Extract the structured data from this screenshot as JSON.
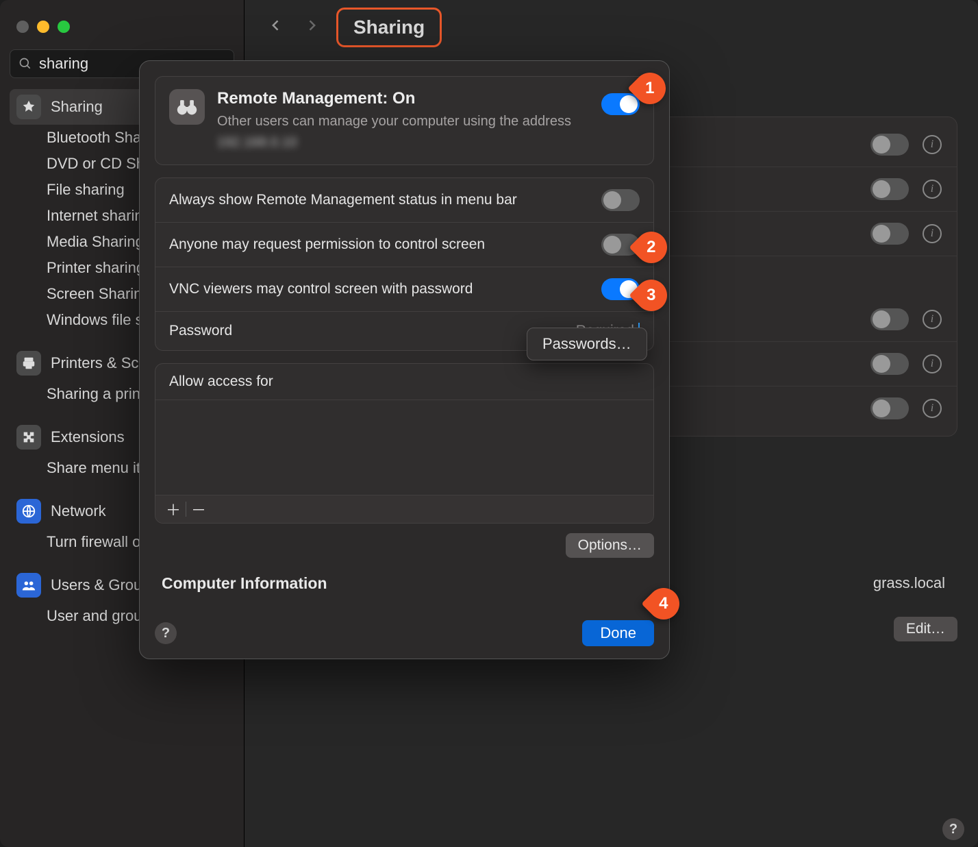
{
  "window": {
    "title": "Sharing"
  },
  "search": {
    "value": "sharing"
  },
  "sidebar": {
    "selected": "Sharing",
    "shared_items": [
      "Bluetooth Sharing",
      "DVD or CD Sharing",
      "File sharing",
      "Internet sharing",
      "Media Sharing",
      "Printer sharing",
      "Screen Sharing",
      "Windows file sharing"
    ],
    "printers": {
      "label": "Printers & Scanners",
      "sub": "Sharing a printer"
    },
    "extensions": {
      "label": "Extensions",
      "sub": "Share menu items"
    },
    "network": {
      "label": "Network",
      "sub": "Turn firewall on or off"
    },
    "users": {
      "label": "Users & Groups",
      "sub": "User and group accounts"
    }
  },
  "background": {
    "hostname": "grass.local",
    "edit_label": "Edit…"
  },
  "sheet": {
    "rm_title": "Remote Management: On",
    "rm_desc": "Other users can manage your computer using the address",
    "rm_addr": "192.168.0.10",
    "rm_on": true,
    "opts": {
      "menubar": {
        "label": "Always show Remote Management status in menu bar",
        "on": false
      },
      "anyone": {
        "label": "Anyone may request permission to control screen",
        "on": false
      },
      "vnc": {
        "label": "VNC viewers may control screen with password",
        "on": true
      },
      "password_label": "Password",
      "password_placeholder": "Required"
    },
    "access_label": "Allow access for",
    "options_label": "Options…",
    "section_title": "Computer Information",
    "done_label": "Done",
    "popover_label": "Passwords…"
  },
  "annotations": [
    "1",
    "2",
    "3",
    "4"
  ]
}
